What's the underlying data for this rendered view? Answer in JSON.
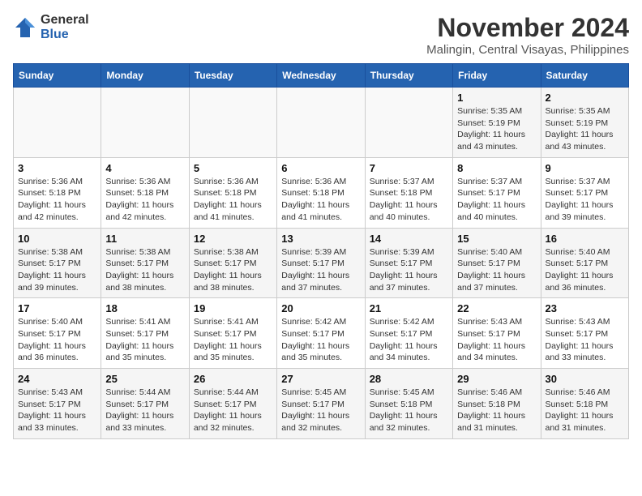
{
  "header": {
    "logo_line1": "General",
    "logo_line2": "Blue",
    "title": "November 2024",
    "subtitle": "Malingin, Central Visayas, Philippines"
  },
  "weekdays": [
    "Sunday",
    "Monday",
    "Tuesday",
    "Wednesday",
    "Thursday",
    "Friday",
    "Saturday"
  ],
  "weeks": [
    [
      {
        "day": "",
        "info": ""
      },
      {
        "day": "",
        "info": ""
      },
      {
        "day": "",
        "info": ""
      },
      {
        "day": "",
        "info": ""
      },
      {
        "day": "",
        "info": ""
      },
      {
        "day": "1",
        "info": "Sunrise: 5:35 AM\nSunset: 5:19 PM\nDaylight: 11 hours and 43 minutes."
      },
      {
        "day": "2",
        "info": "Sunrise: 5:35 AM\nSunset: 5:19 PM\nDaylight: 11 hours and 43 minutes."
      }
    ],
    [
      {
        "day": "3",
        "info": "Sunrise: 5:36 AM\nSunset: 5:18 PM\nDaylight: 11 hours and 42 minutes."
      },
      {
        "day": "4",
        "info": "Sunrise: 5:36 AM\nSunset: 5:18 PM\nDaylight: 11 hours and 42 minutes."
      },
      {
        "day": "5",
        "info": "Sunrise: 5:36 AM\nSunset: 5:18 PM\nDaylight: 11 hours and 41 minutes."
      },
      {
        "day": "6",
        "info": "Sunrise: 5:36 AM\nSunset: 5:18 PM\nDaylight: 11 hours and 41 minutes."
      },
      {
        "day": "7",
        "info": "Sunrise: 5:37 AM\nSunset: 5:18 PM\nDaylight: 11 hours and 40 minutes."
      },
      {
        "day": "8",
        "info": "Sunrise: 5:37 AM\nSunset: 5:17 PM\nDaylight: 11 hours and 40 minutes."
      },
      {
        "day": "9",
        "info": "Sunrise: 5:37 AM\nSunset: 5:17 PM\nDaylight: 11 hours and 39 minutes."
      }
    ],
    [
      {
        "day": "10",
        "info": "Sunrise: 5:38 AM\nSunset: 5:17 PM\nDaylight: 11 hours and 39 minutes."
      },
      {
        "day": "11",
        "info": "Sunrise: 5:38 AM\nSunset: 5:17 PM\nDaylight: 11 hours and 38 minutes."
      },
      {
        "day": "12",
        "info": "Sunrise: 5:38 AM\nSunset: 5:17 PM\nDaylight: 11 hours and 38 minutes."
      },
      {
        "day": "13",
        "info": "Sunrise: 5:39 AM\nSunset: 5:17 PM\nDaylight: 11 hours and 37 minutes."
      },
      {
        "day": "14",
        "info": "Sunrise: 5:39 AM\nSunset: 5:17 PM\nDaylight: 11 hours and 37 minutes."
      },
      {
        "day": "15",
        "info": "Sunrise: 5:40 AM\nSunset: 5:17 PM\nDaylight: 11 hours and 37 minutes."
      },
      {
        "day": "16",
        "info": "Sunrise: 5:40 AM\nSunset: 5:17 PM\nDaylight: 11 hours and 36 minutes."
      }
    ],
    [
      {
        "day": "17",
        "info": "Sunrise: 5:40 AM\nSunset: 5:17 PM\nDaylight: 11 hours and 36 minutes."
      },
      {
        "day": "18",
        "info": "Sunrise: 5:41 AM\nSunset: 5:17 PM\nDaylight: 11 hours and 35 minutes."
      },
      {
        "day": "19",
        "info": "Sunrise: 5:41 AM\nSunset: 5:17 PM\nDaylight: 11 hours and 35 minutes."
      },
      {
        "day": "20",
        "info": "Sunrise: 5:42 AM\nSunset: 5:17 PM\nDaylight: 11 hours and 35 minutes."
      },
      {
        "day": "21",
        "info": "Sunrise: 5:42 AM\nSunset: 5:17 PM\nDaylight: 11 hours and 34 minutes."
      },
      {
        "day": "22",
        "info": "Sunrise: 5:43 AM\nSunset: 5:17 PM\nDaylight: 11 hours and 34 minutes."
      },
      {
        "day": "23",
        "info": "Sunrise: 5:43 AM\nSunset: 5:17 PM\nDaylight: 11 hours and 33 minutes."
      }
    ],
    [
      {
        "day": "24",
        "info": "Sunrise: 5:43 AM\nSunset: 5:17 PM\nDaylight: 11 hours and 33 minutes."
      },
      {
        "day": "25",
        "info": "Sunrise: 5:44 AM\nSunset: 5:17 PM\nDaylight: 11 hours and 33 minutes."
      },
      {
        "day": "26",
        "info": "Sunrise: 5:44 AM\nSunset: 5:17 PM\nDaylight: 11 hours and 32 minutes."
      },
      {
        "day": "27",
        "info": "Sunrise: 5:45 AM\nSunset: 5:17 PM\nDaylight: 11 hours and 32 minutes."
      },
      {
        "day": "28",
        "info": "Sunrise: 5:45 AM\nSunset: 5:18 PM\nDaylight: 11 hours and 32 minutes."
      },
      {
        "day": "29",
        "info": "Sunrise: 5:46 AM\nSunset: 5:18 PM\nDaylight: 11 hours and 31 minutes."
      },
      {
        "day": "30",
        "info": "Sunrise: 5:46 AM\nSunset: 5:18 PM\nDaylight: 11 hours and 31 minutes."
      }
    ]
  ]
}
